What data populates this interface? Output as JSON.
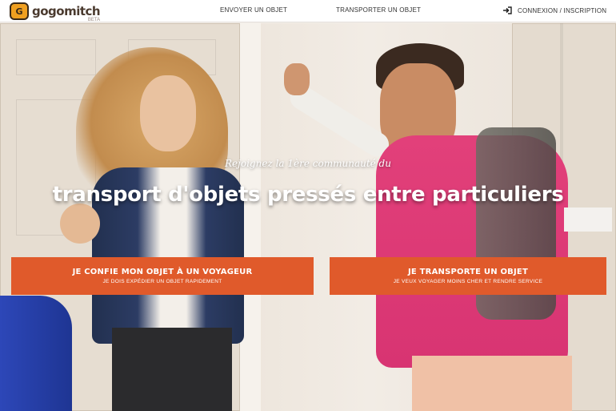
{
  "header": {
    "logo_text": "gogomitch",
    "logo_badge": "BETA",
    "nav": {
      "send": "ENVOYER UN OBJET",
      "transport": "TRANSPORTER UN OBJET",
      "login": "CONNEXION / INSCRIPTION"
    }
  },
  "hero": {
    "tagline": "Rejoignez la 1ère communauté du",
    "headline": "transport d'objets pressés entre particuliers",
    "cta_left": {
      "title": "JE CONFIE MON OBJET À UN VOYAGEUR",
      "subtitle": "JE DOIS EXPÉDIER UN OBJET RAPIDEMENT"
    },
    "cta_right": {
      "title": "JE TRANSPORTE UN OBJET",
      "subtitle": "JE VEUX VOYAGER MOINS CHER ET RENDRE SERVICE"
    }
  },
  "colors": {
    "accent": "#e05a2b",
    "logo": "#f0a020"
  },
  "icons": {
    "logo": "suitcase-logo-icon",
    "login": "sign-in-icon"
  }
}
